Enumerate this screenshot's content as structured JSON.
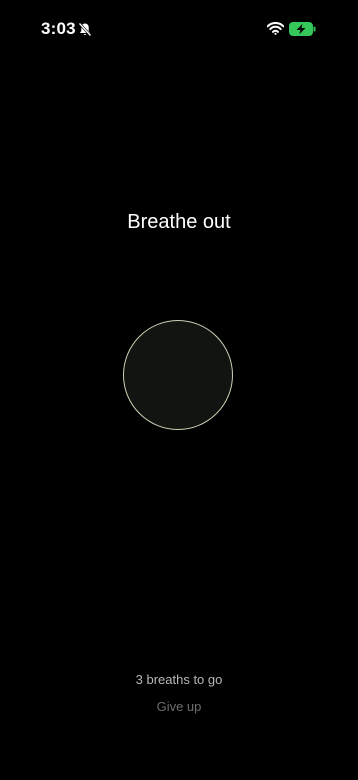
{
  "status_bar": {
    "time": "3:03",
    "icons": [
      "silent-mode-icon",
      "wifi-icon",
      "battery-charging-icon"
    ],
    "battery_color": "#35c759"
  },
  "exercise": {
    "instruction": "Breathe out",
    "breaths_remaining": "3 breaths to go",
    "give_up_label": "Give up",
    "circle_stroke_color": "#c9d2b4",
    "circle_fill_color": "#121411"
  }
}
